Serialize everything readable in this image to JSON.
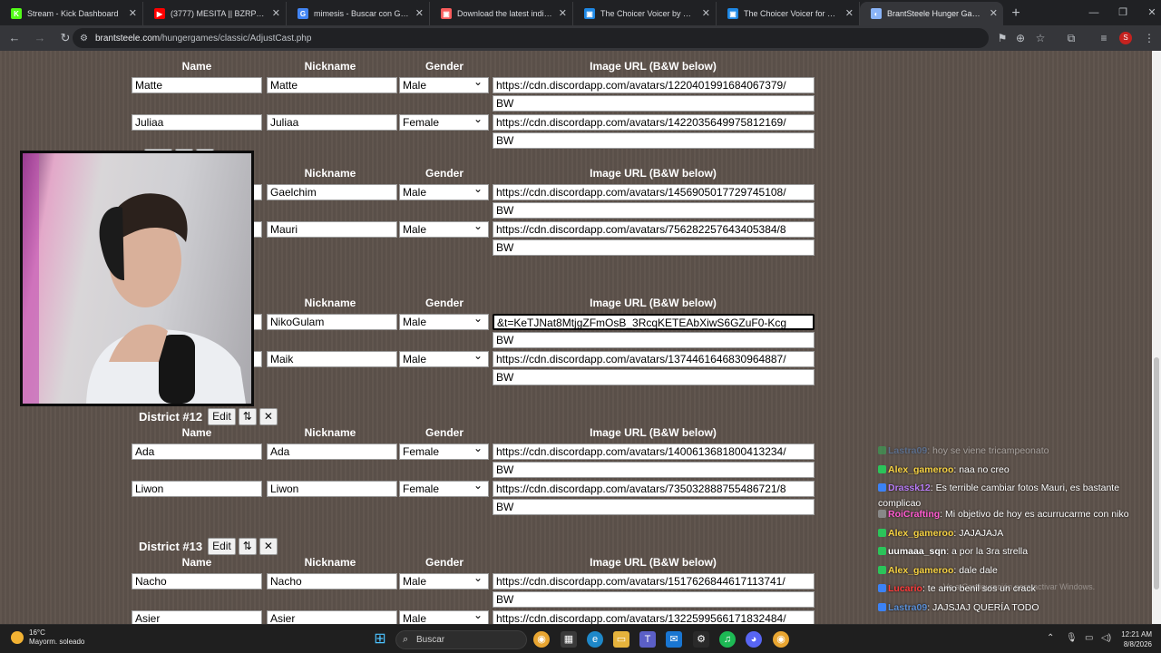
{
  "browser": {
    "tabs": [
      {
        "title": "Stream - Kick Dashboard",
        "icon": "kick-icon",
        "color": "#53fc18",
        "glyph": "K"
      },
      {
        "title": "(3777) MESITA || BZRP Music Se",
        "icon": "youtube-icon",
        "color": "#ff0000",
        "glyph": "▶"
      },
      {
        "title": "mimesis - Buscar con Google",
        "icon": "google-icon",
        "color": "#4285f4",
        "glyph": "G"
      },
      {
        "title": "Download the latest indie game",
        "icon": "itch-icon",
        "color": "#fa5c5c",
        "glyph": "▣"
      },
      {
        "title": "The Choicer Voicer by YeahMay",
        "icon": "itch-icon",
        "color": "#1e88e5",
        "glyph": "▣"
      },
      {
        "title": "The Choicer Voicer for Window",
        "icon": "itch-icon",
        "color": "#1e88e5",
        "glyph": "▣"
      },
      {
        "title": "BrantSteele Hunger Games Simu",
        "icon": "brantsteele-icon",
        "color": "#8ab4f8",
        "glyph": "◐",
        "active": true
      }
    ],
    "url_domain": "brantsteele.com",
    "url_path": "/hungergames/classic/AdjustCast.php",
    "profile_initial": "S"
  },
  "page": {
    "labels": {
      "name": "Name",
      "nickname": "Nickname",
      "gender": "Gender",
      "image_url": "Image URL (B&W below)",
      "bw": "BW",
      "edit": "Edit",
      "swap": "⇅",
      "remove": "✕"
    },
    "districts": [
      {
        "title": "",
        "show_header": false,
        "rows": [
          {
            "name": "Matte",
            "nick": "Matte",
            "gender": "Male",
            "img": "https://cdn.discordapp.com/avatars/1220401991684067379/"
          },
          {
            "name": "Juliaa",
            "nick": "Juliaa",
            "gender": "Female",
            "img": "https://cdn.discordapp.com/avatars/1422035649975812169/"
          }
        ]
      },
      {
        "title": "",
        "show_header": true,
        "rows": [
          {
            "name": "",
            "nick": "Gaelchim",
            "gender": "Male",
            "img": "https://cdn.discordapp.com/avatars/1456905017729745108/"
          },
          {
            "name": "",
            "nick": "Mauri",
            "gender": "Male",
            "img": "https://cdn.discordapp.com/avatars/756282257643405384/8"
          }
        ]
      },
      {
        "title": "",
        "show_header": true,
        "rows": [
          {
            "name": "",
            "nick": "NikoGulam",
            "gender": "Male",
            "img": "&t=KeTJNat8MtjgZFmOsB_3RcqKETEAbXiwS6GZuF0-Kcg",
            "focused": true
          },
          {
            "name": "",
            "nick": "Maik",
            "gender": "Male",
            "img": "https://cdn.discordapp.com/avatars/1374461646830964887/"
          }
        ]
      },
      {
        "title": "District #12",
        "show_header": true,
        "rows": [
          {
            "name": "Ada",
            "nick": "Ada",
            "gender": "Female",
            "img": "https://cdn.discordapp.com/avatars/1400613681800413234/"
          },
          {
            "name": "Liwon",
            "nick": "Liwon",
            "gender": "Female",
            "img": "https://cdn.discordapp.com/avatars/735032888755486721/8"
          }
        ]
      },
      {
        "title": "District #13",
        "show_header": true,
        "rows": [
          {
            "name": "Nacho",
            "nick": "Nacho",
            "gender": "Male",
            "img": "https://cdn.discordapp.com/avatars/1517626844617113741/"
          },
          {
            "name": "Asier",
            "nick": "Asier",
            "gender": "Male",
            "img": "https://cdn.discordapp.com/avatars/1322599566171832484/"
          }
        ]
      }
    ]
  },
  "chat": [
    {
      "user": "Lastra09",
      "text": "hoy se viene tricampeonato",
      "color": "#5a8fd6",
      "faded": true
    },
    {
      "user": "Alex_gameroo",
      "text": "naa no creo",
      "color": "#f5d142"
    },
    {
      "user": "Drassk12",
      "text": "Es terrible cambiar fotos Mauri, es bastante complicao",
      "color": "#b77cf5"
    },
    {
      "user": "RoiCrafting",
      "text": "Mi objetivo de hoy es acurrucarme con niko",
      "color": "#ff5bd0"
    },
    {
      "user": "Alex_gameroo",
      "text": "JAJAJAJA",
      "color": "#f5d142"
    },
    {
      "user": "uumaaa_sqn",
      "text": "a por la 3ra strella",
      "color": "#ffffff"
    },
    {
      "user": "Alex_gameroo",
      "text": "dale dale",
      "color": "#f5d142"
    },
    {
      "user": "Lucario",
      "text": "te amo benil sos un crack",
      "color": "#ff3b3b"
    },
    {
      "user": "Lastra09",
      "text": "JAJSJAJ QUERÍA TODO",
      "color": "#5a8fd6"
    }
  ],
  "watermark": "Ve a Configuración para activar Windows.",
  "taskbar": {
    "temp": "16°C",
    "weather": "Mayorm. soleado",
    "search_placeholder": "Buscar",
    "time": "12:21 AM",
    "date": "8/8/2026"
  }
}
